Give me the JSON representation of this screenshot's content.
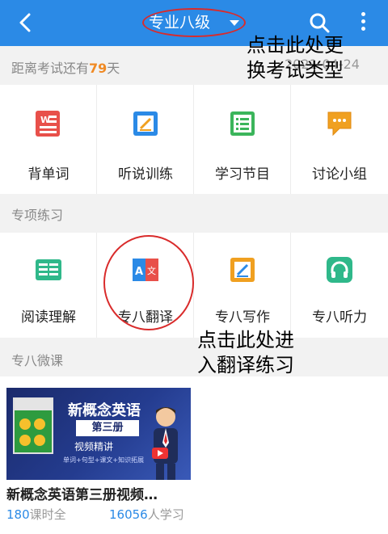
{
  "header": {
    "title": "专业八级",
    "icons": [
      "back-arrow-icon",
      "chevron-down-icon",
      "search-icon",
      "more-vertical-icon"
    ],
    "accent_color": "#2b8ae6"
  },
  "countdown": {
    "prefix": "距离考试还有",
    "days": "79",
    "suffix": "天",
    "date": "2021-04-24"
  },
  "main_grid": {
    "items": [
      {
        "label": "背单词",
        "icon": "word-card-icon",
        "color": "#e8504a"
      },
      {
        "label": "听说训练",
        "icon": "pen-note-icon",
        "color": "#2b8ae6"
      },
      {
        "label": "学习节目",
        "icon": "list-icon",
        "color": "#3bb55b"
      },
      {
        "label": "讨论小组",
        "icon": "chat-bubble-icon",
        "color": "#f0a020"
      }
    ]
  },
  "practice": {
    "heading": "专项练习",
    "items": [
      {
        "label": "阅读理解",
        "icon": "open-book-icon",
        "color": "#2fb88a"
      },
      {
        "label": "专八翻译",
        "icon": "translate-icon",
        "color": "#2b8ae6"
      },
      {
        "label": "专八写作",
        "icon": "pen-note-icon",
        "color": "#f0a020"
      },
      {
        "label": "专八听力",
        "icon": "headphones-icon",
        "color": "#2fb88a"
      }
    ]
  },
  "course_section": {
    "heading": "专八微课",
    "course": {
      "title": "新概念英语第三册视频…",
      "thumb_title": "新概念英语",
      "thumb_badge": "第三册",
      "thumb_sub": "视频精讲",
      "thumb_tags": "单词+句型+课文+知识拓展",
      "book_cover_text": "新概念英语",
      "lessons_count": "180",
      "lessons_label": "课时全",
      "learners_count": "16056",
      "learners_label": "人学习"
    }
  },
  "annotations": {
    "exam_type": {
      "line1": "点击此处更",
      "line2": "换考试类型"
    },
    "translation": {
      "line1": "点击此处进",
      "line2": "入翻译练习"
    },
    "color": "#d92b2b"
  }
}
